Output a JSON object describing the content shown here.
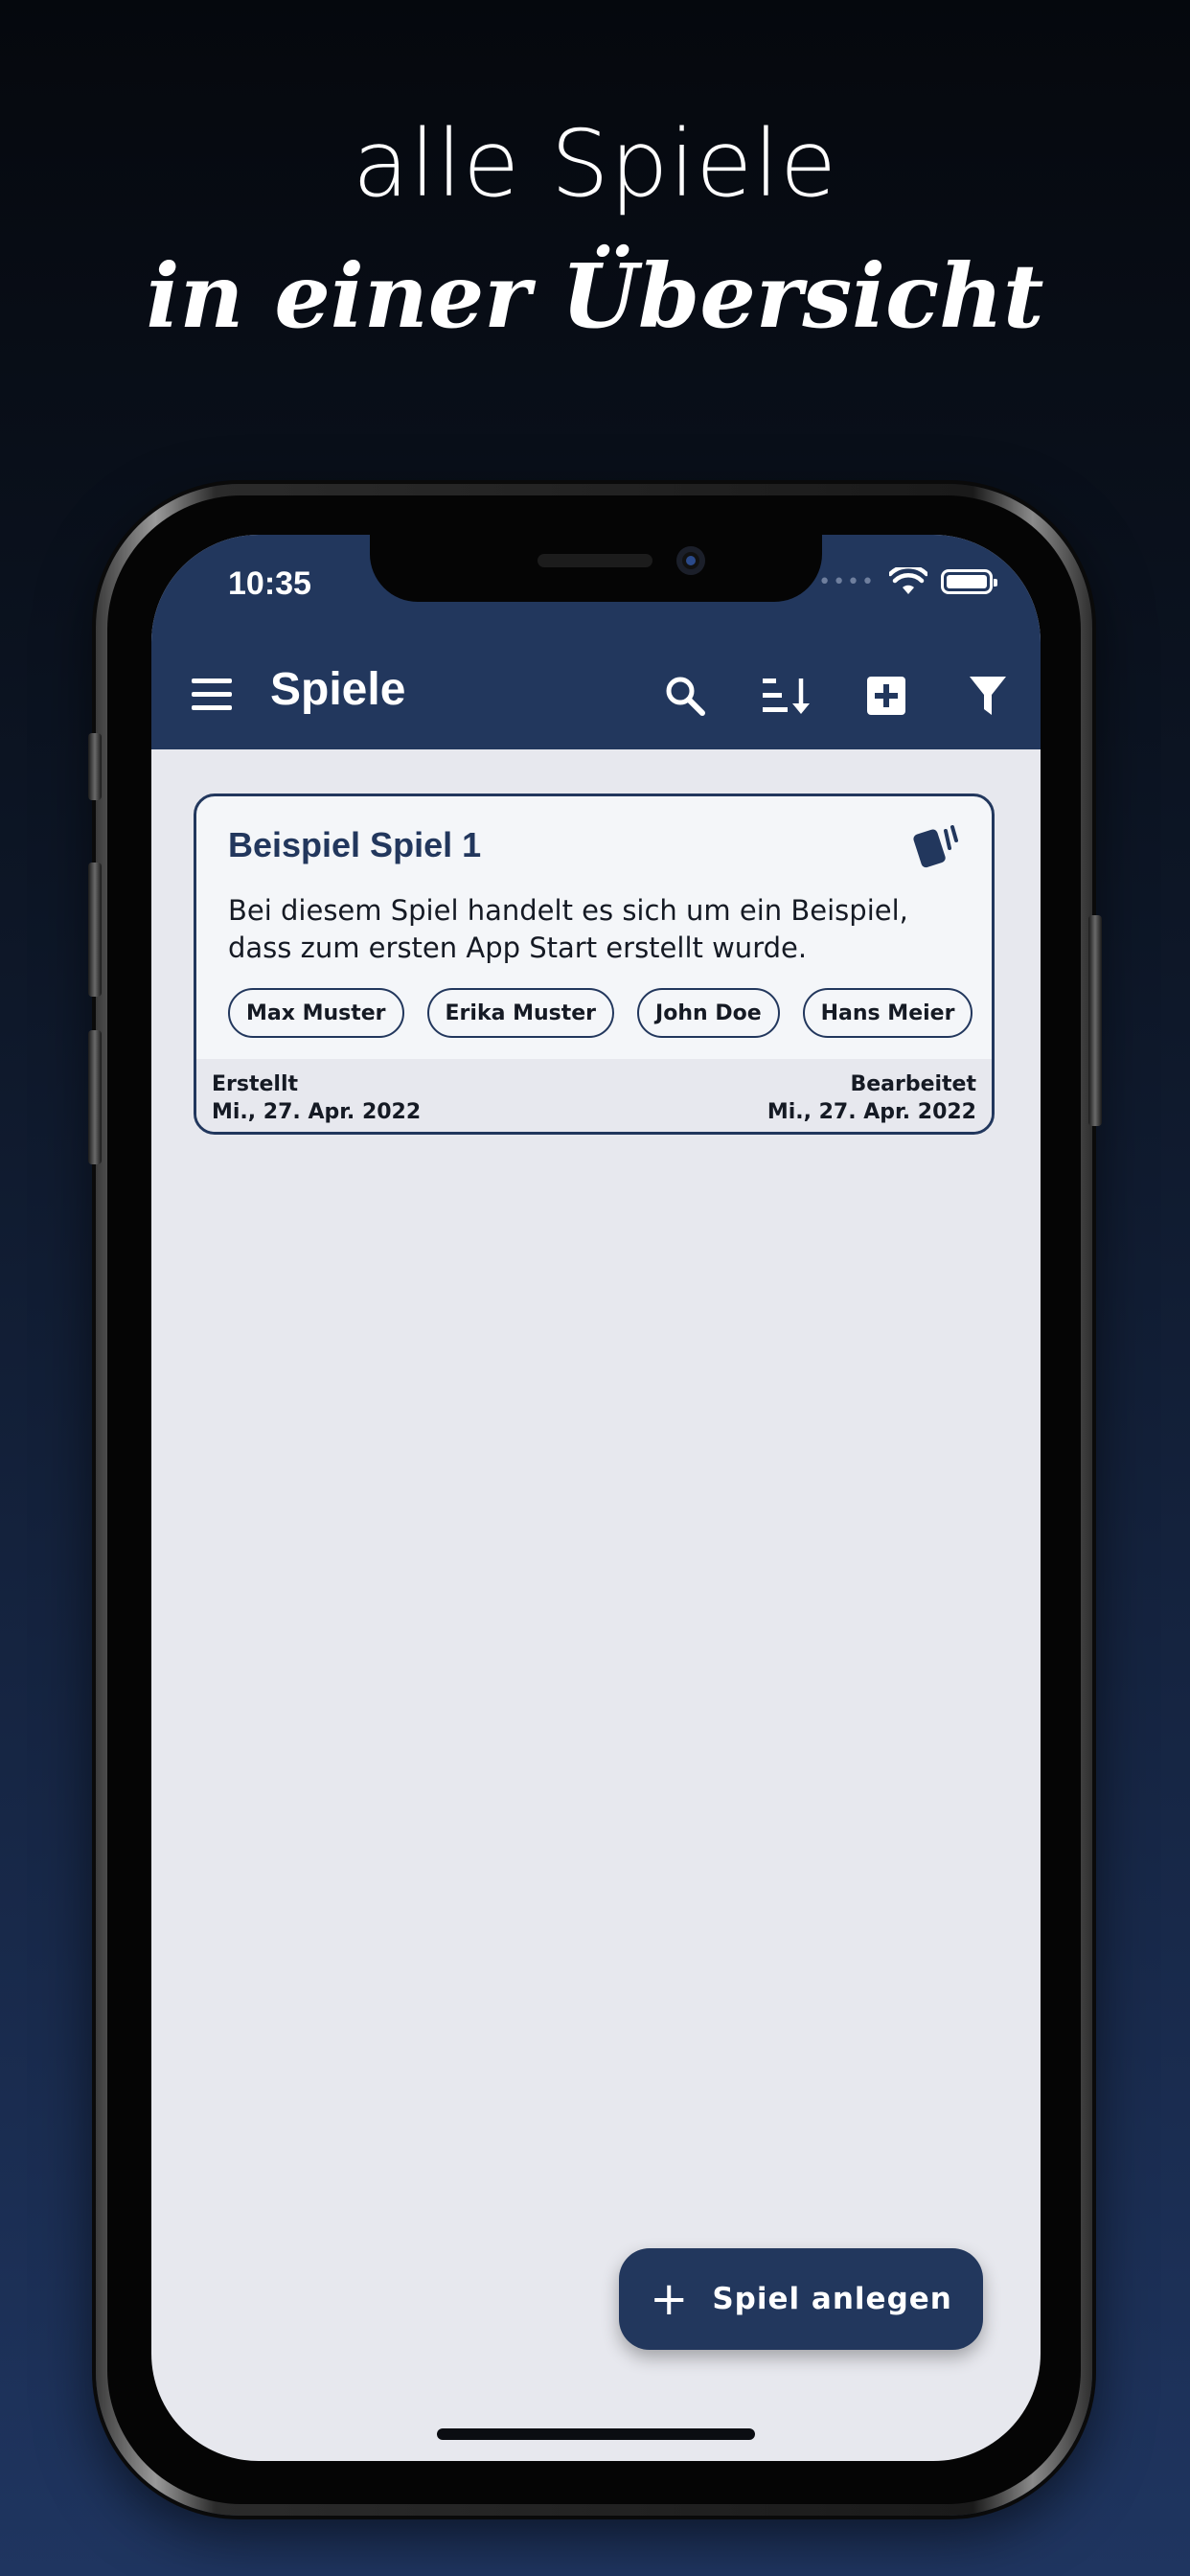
{
  "headline": {
    "line1": "alle Spiele",
    "line2": "in einer Übersicht"
  },
  "statusbar": {
    "time": "10:35",
    "signal": "••••"
  },
  "appbar": {
    "title": "Spiele",
    "actions": [
      "search-icon",
      "sort-icon",
      "add-box-icon",
      "filter-icon"
    ]
  },
  "games": [
    {
      "title": "Beispiel Spiel 1",
      "description": "Bei diesem Spiel handelt es sich um ein Beispiel, dass zum ersten App Start erstellt wurde.",
      "players": [
        "Max Muster",
        "Erika Muster",
        "John Doe",
        "Hans Meier"
      ],
      "created_label": "Erstellt",
      "created_date": "Mi., 27. Apr. 2022",
      "edited_label": "Bearbeitet",
      "edited_date": "Mi., 27. Apr. 2022"
    }
  ],
  "fab": {
    "label": "Spiel anlegen",
    "icon": "plus-icon"
  },
  "colors": {
    "primary": "#22375d",
    "background": "#e7e8ee",
    "card": "#f4f6f9"
  }
}
